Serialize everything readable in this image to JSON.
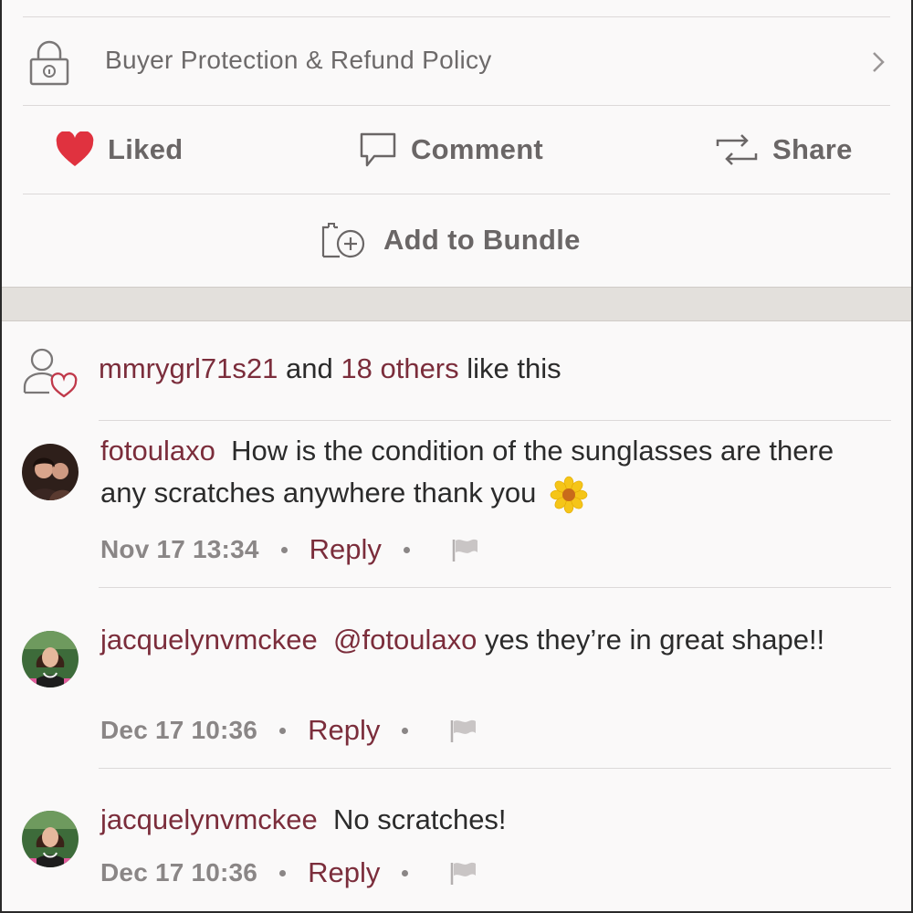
{
  "policy": {
    "label": "Buyer Protection & Refund Policy",
    "icon": "lock-icon",
    "chevron_icon": "chevron-right-icon"
  },
  "actions": {
    "liked": {
      "label": "Liked",
      "icon": "heart-icon",
      "color": "#e0323f"
    },
    "comment": {
      "label": "Comment",
      "icon": "speech-bubble-icon"
    },
    "share": {
      "label": "Share",
      "icon": "share-arrows-icon"
    },
    "bundle": {
      "label": "Add to Bundle",
      "icon": "bundle-add-icon"
    }
  },
  "likes": {
    "user": "mmrygrl71s21",
    "and": "and",
    "others": "18 others",
    "suffix": "like this",
    "icon": "user-heart-icon"
  },
  "comments": [
    {
      "user": "fotoulaxo",
      "mention": "",
      "text": "How is the condition of the sunglasses are there any scratches anywhere thank you",
      "emoji": "sunflower",
      "time": "Nov 17 13:34",
      "reply": "Reply"
    },
    {
      "user": "jacquelynvmckee",
      "mention": "@fotoulaxo",
      "text": "yes they’re in great shape!!",
      "time": "Dec 17 10:36",
      "reply": "Reply"
    },
    {
      "user": "jacquelynvmckee",
      "mention": "",
      "text": "No scratches!",
      "time": "Dec 17 10:36",
      "reply": "Reply"
    }
  ],
  "colors": {
    "accent": "#7b2d3b",
    "muted": "#8a8686",
    "heart": "#e0323f"
  }
}
